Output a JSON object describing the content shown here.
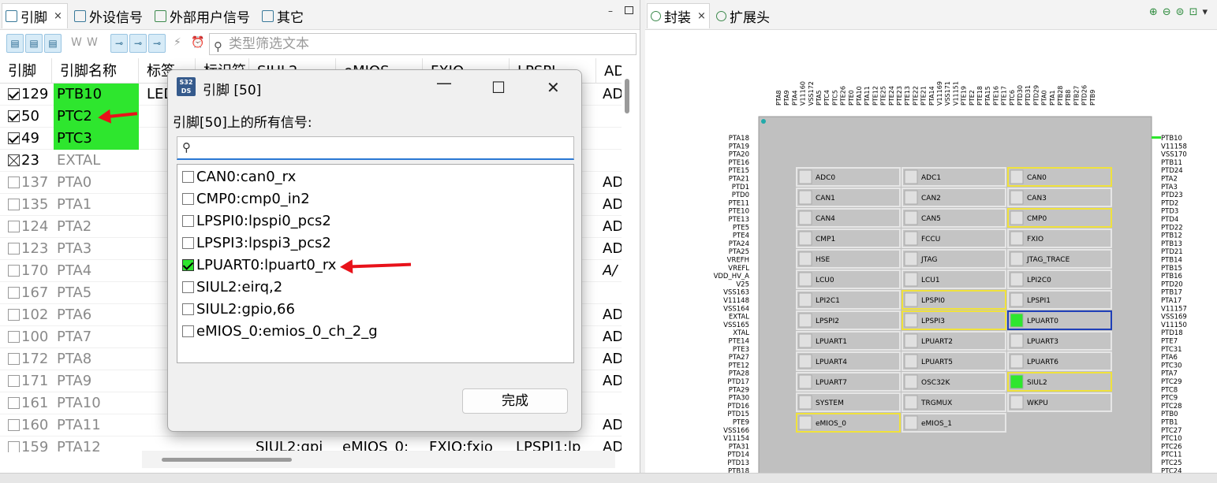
{
  "left_tabs": [
    {
      "label": "引脚",
      "close": "×",
      "icon": "table-icon"
    },
    {
      "label": "外设信号",
      "icon": "chart-icon"
    },
    {
      "label": "外部用户信号",
      "icon": "signal-icon"
    },
    {
      "label": "其它",
      "icon": "list-icon"
    }
  ],
  "right_tabs": [
    {
      "label": "封装",
      "close": "×",
      "icon": "chip-icon"
    },
    {
      "label": "扩展头",
      "icon": "chip-icon"
    }
  ],
  "window_controls": {
    "minimize": "–",
    "maximize": "□"
  },
  "filter": {
    "placeholder": "类型筛选文本",
    "icon": "search-icon"
  },
  "toolbar_glyphs": {
    "g1": "W",
    "g2": "W",
    "g3": "⚡",
    "g4": "⏰"
  },
  "columns": [
    "引脚",
    "引脚名称",
    "标签",
    "标识符",
    "SIUL2",
    "eMIOS",
    "FXIO",
    "LPSPI",
    "AD"
  ],
  "rows": [
    {
      "state": "on",
      "num": "129",
      "name": "PTB10",
      "highlight": true,
      "label": "LED",
      "col9": "AD"
    },
    {
      "state": "on",
      "num": "50",
      "name": "PTC2",
      "highlight": true,
      "label": "",
      "col9": "",
      "col8": "..."
    },
    {
      "state": "on",
      "num": "49",
      "name": "PTC3",
      "highlight": true,
      "label": "",
      "col9": ""
    },
    {
      "state": "x",
      "num": "23",
      "name": "EXTAL",
      "highlight": false,
      "label": "",
      "col9": ""
    },
    {
      "state": "off",
      "num": "137",
      "name": "PTA0",
      "highlight": false,
      "label": "",
      "col9": "AD",
      "col8": "..."
    },
    {
      "state": "off",
      "num": "135",
      "name": "PTA1",
      "highlight": false,
      "label": "",
      "col9": "AD",
      "col8": "..."
    },
    {
      "state": "off",
      "num": "124",
      "name": "PTA2",
      "highlight": false,
      "label": "",
      "col9": "AD",
      "col8": "..."
    },
    {
      "state": "off",
      "num": "123",
      "name": "PTA3",
      "highlight": false,
      "label": "",
      "col9": "AD",
      "col8": "..."
    },
    {
      "state": "off",
      "num": "170",
      "name": "PTA4",
      "highlight": false,
      "label": "",
      "col9": "A/",
      "col8": "..."
    },
    {
      "state": "off",
      "num": "167",
      "name": "PTA5",
      "highlight": false,
      "label": "",
      "col9": ""
    },
    {
      "state": "off",
      "num": "102",
      "name": "PTA6",
      "highlight": false,
      "label": "",
      "col9": "AD",
      "col8": "..."
    },
    {
      "state": "off",
      "num": "100",
      "name": "PTA7",
      "highlight": false,
      "label": "",
      "col9": "AD",
      "col8": "..."
    },
    {
      "state": "off",
      "num": "172",
      "name": "PTA8",
      "highlight": false,
      "label": "",
      "col9": "AD",
      "col8": "..."
    },
    {
      "state": "off",
      "num": "171",
      "name": "PTA9",
      "highlight": false,
      "label": "",
      "col9": "AD",
      "col8": "..."
    },
    {
      "state": "off",
      "num": "161",
      "name": "PTA10",
      "highlight": false,
      "label": "",
      "col9": ""
    },
    {
      "state": "off",
      "num": "160",
      "name": "PTA11",
      "highlight": false,
      "label": "",
      "col9": "AD",
      "col8": "..."
    },
    {
      "state": "off",
      "num": "159",
      "name": "PTA12",
      "highlight": false,
      "label": "",
      "col5": "SIUL2:gpi",
      "col6": "eMIOS_0:",
      "col7": "FXIO:fxio",
      "col8": "LPSPI1:lp",
      "col9": "AD"
    }
  ],
  "dialog": {
    "title": "引脚 [50]",
    "icon_text": "S32 DS",
    "prompt": "引脚[50]上的所有信号:",
    "search_icon": "search-icon",
    "done": "完成",
    "close": "✕",
    "maximize": "☐",
    "minimize": "—",
    "items": [
      {
        "label": "CAN0:can0_rx",
        "checked": false
      },
      {
        "label": "CMP0:cmp0_in2",
        "checked": false
      },
      {
        "label": "LPSPI0:lpspi0_pcs2",
        "checked": false
      },
      {
        "label": "LPSPI3:lpspi3_pcs2",
        "checked": false
      },
      {
        "label": "LPUART0:lpuart0_rx",
        "checked": true
      },
      {
        "label": "SIUL2:eirq,2",
        "checked": false
      },
      {
        "label": "SIUL2:gpio,66",
        "checked": false
      },
      {
        "label": "eMIOS_0:emios_0_ch_2_g",
        "checked": false
      }
    ]
  },
  "package": {
    "top_pins": [
      "PTA8",
      "PTA9",
      "PTA4",
      "V11160",
      "VSS172",
      "PTA5",
      "PTC4",
      "PTC5",
      "PTE26",
      "PTE0",
      "PTA10",
      "PTA11",
      "PTE12",
      "PTE25",
      "PTE24",
      "PTE23",
      "PTE13",
      "PTE22",
      "PTE21",
      "PTA14",
      "V11169",
      "VSS171",
      "V11151",
      "PTE19",
      "PTE2",
      "PTE18",
      "PTA15",
      "PTE16",
      "PTE17",
      "PTC6",
      "PTD30",
      "PTD31",
      "PTD29",
      "PTA0",
      "PTA1",
      "PTB28",
      "PTB8",
      "PTB27",
      "PTD26",
      "PTB9"
    ],
    "left_pins": [
      "PTA18",
      "PTA19",
      "PTA20",
      "PTE16",
      "PTE15",
      "PTA21",
      "PTD1",
      "PTD0",
      "PTE11",
      "PTE10",
      "PTE13",
      "PTE5",
      "PTE4",
      "PTA24",
      "PTA25",
      "VREFH",
      "VREFL",
      "VDD_HV_A",
      "V25",
      "VSS163",
      "V11148",
      "VSS164",
      "EXTAL",
      "VSS165",
      "XTAL",
      "PTE14",
      "PTE3",
      "PTA27",
      "PTE12",
      "PTA28",
      "PTD17",
      "PTA29",
      "PTA30",
      "PTD16",
      "PTD15",
      "PTE9",
      "VSS166",
      "V11154",
      "PTA31",
      "PTD14",
      "PTD13",
      "PTB18"
    ],
    "right_pins": [
      "PTB10",
      "V11158",
      "VSS170",
      "PTB11",
      "PTD24",
      "PTA2",
      "PTA3",
      "PTD23",
      "PTD2",
      "PTD3",
      "PTD4",
      "PTD22",
      "PTB12",
      "PTB13",
      "PTD21",
      "PTB14",
      "PTB15",
      "PTB16",
      "PTD20",
      "PTB17",
      "PTA17",
      "V11157",
      "VSS169",
      "V11150",
      "PTD18",
      "PTE7",
      "PTC31",
      "PTA6",
      "PTC30",
      "PTA7",
      "PTC29",
      "PTC8",
      "PTC9",
      "PTC28",
      "PTB0",
      "PTB1",
      "PTC27",
      "PTC10",
      "PTC26",
      "PTC11",
      "PTC25",
      "PTC24"
    ],
    "blocks": [
      {
        "label": "ADC0",
        "state": "none"
      },
      {
        "label": "ADC1",
        "state": "none"
      },
      {
        "label": "CAN0",
        "state": "yellow"
      },
      {
        "label": "CAN1",
        "state": "none"
      },
      {
        "label": "CAN2",
        "state": "none"
      },
      {
        "label": "CAN3",
        "state": "none"
      },
      {
        "label": "CAN4",
        "state": "none"
      },
      {
        "label": "CAN5",
        "state": "none"
      },
      {
        "label": "CMP0",
        "state": "yellow"
      },
      {
        "label": "CMP1",
        "state": "none"
      },
      {
        "label": "FCCU",
        "state": "none"
      },
      {
        "label": "FXIO",
        "state": "none"
      },
      {
        "label": "HSE",
        "state": "none"
      },
      {
        "label": "JTAG",
        "state": "none"
      },
      {
        "label": "JTAG_TRACE",
        "state": "none"
      },
      {
        "label": "LCU0",
        "state": "none"
      },
      {
        "label": "LCU1",
        "state": "none"
      },
      {
        "label": "LPI2C0",
        "state": "none"
      },
      {
        "label": "LPI2C1",
        "state": "none"
      },
      {
        "label": "LPSPI0",
        "state": "yellow"
      },
      {
        "label": "LPSPI1",
        "state": "none"
      },
      {
        "label": "LPSPI2",
        "state": "none"
      },
      {
        "label": "LPSPI3",
        "state": "yellow"
      },
      {
        "label": "LPUART0",
        "state": "blue-green"
      },
      {
        "label": "LPUART1",
        "state": "none"
      },
      {
        "label": "LPUART2",
        "state": "none"
      },
      {
        "label": "LPUART3",
        "state": "none"
      },
      {
        "label": "LPUART4",
        "state": "none"
      },
      {
        "label": "LPUART5",
        "state": "none"
      },
      {
        "label": "LPUART6",
        "state": "none"
      },
      {
        "label": "LPUART7",
        "state": "none"
      },
      {
        "label": "OSC32K",
        "state": "none"
      },
      {
        "label": "SIUL2",
        "state": "yellow-green"
      },
      {
        "label": "SYSTEM",
        "state": "none"
      },
      {
        "label": "TRGMUX",
        "state": "none"
      },
      {
        "label": "WKPU",
        "state": "none"
      },
      {
        "label": "eMIOS_0",
        "state": "yellow"
      },
      {
        "label": "eMIOS_1",
        "state": "none"
      }
    ]
  },
  "colors": {
    "green": "#2ee62e",
    "yellow": "#f0e23c",
    "blue": "#1f3fb8",
    "arrow": "#e8121a",
    "chip": "#c0c0c0"
  }
}
